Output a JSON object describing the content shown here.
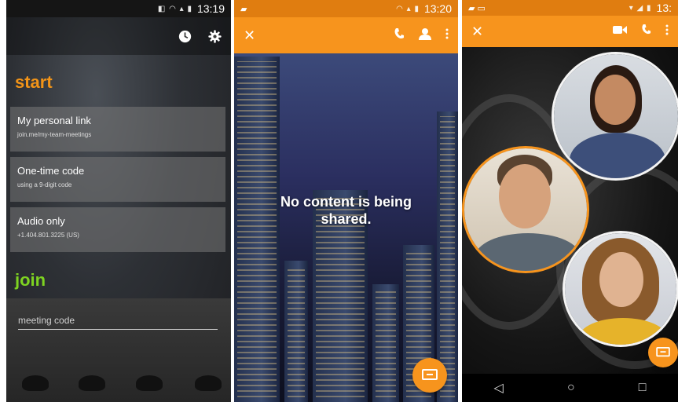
{
  "screen1": {
    "status_time": "13:19",
    "section_start": "start",
    "options": [
      {
        "title": "My personal link",
        "subtitle": "join.me/my-team-meetings"
      },
      {
        "title": "One-time code",
        "subtitle": "using a 9-digit code"
      },
      {
        "title": "Audio only",
        "subtitle": "+1.404.801.3225 (US)"
      }
    ],
    "section_join": "join",
    "meeting_code_placeholder": "meeting code",
    "icons": [
      "history-icon",
      "settings-gear-icon"
    ]
  },
  "screen2": {
    "status_time": "13:20",
    "message": "No content is being shared.",
    "icons": [
      "close-icon",
      "phone-icon",
      "person-icon",
      "more-vert-icon",
      "screen-share-icon"
    ]
  },
  "screen3": {
    "status_time": "13:",
    "icons": [
      "close-icon",
      "video-camera-icon",
      "phone-icon",
      "more-vert-icon",
      "screen-share-icon",
      "nav-back-icon",
      "nav-home-icon",
      "nav-recents-icon"
    ],
    "nav": {
      "back": "◁",
      "home": "○",
      "recents": "□"
    }
  },
  "colors": {
    "accent": "#f7941d",
    "start_title": "#f29418",
    "join_title": "#7ed321"
  }
}
